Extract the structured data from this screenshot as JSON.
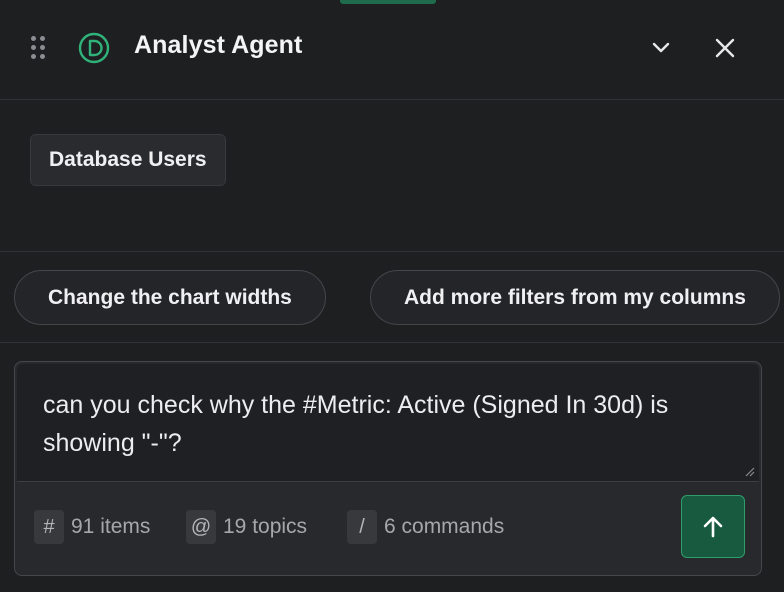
{
  "header": {
    "title": "Analyst Agent",
    "icons": {
      "drag": "drag-handle-icon",
      "logo": "agent-logo-icon",
      "collapse": "chevron-down-icon",
      "close": "close-icon"
    }
  },
  "context": {
    "chip_label": "Database Users"
  },
  "suggestions": [
    {
      "label": "Change the chart widths"
    },
    {
      "label": "Add more filters from my columns"
    }
  ],
  "composer": {
    "message": "can you check why the #Metric: Active (Signed In 30d) is showing \"-\"?",
    "meta": [
      {
        "symbol": "#",
        "text": "91 items"
      },
      {
        "symbol": "@",
        "text": "19 topics"
      },
      {
        "symbol": "/",
        "text": "6 commands"
      }
    ],
    "send_icon": "arrow-up-icon"
  },
  "colors": {
    "background": "#1e1f21",
    "accent": "#2e9e6c",
    "accent_fill": "#175a3f"
  }
}
